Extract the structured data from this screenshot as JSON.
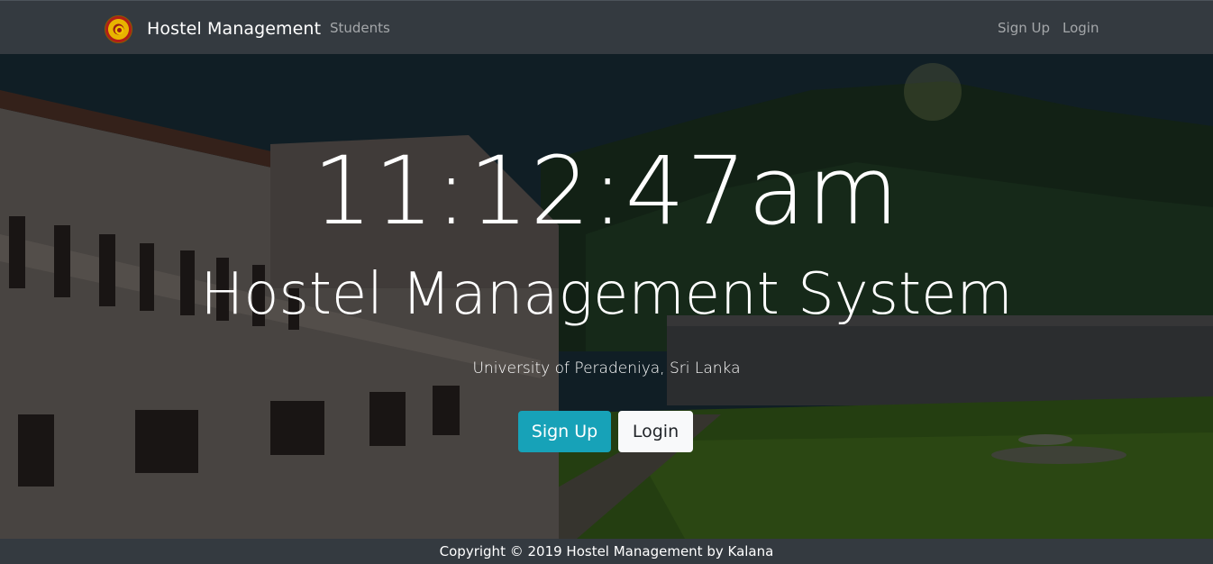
{
  "navbar": {
    "brand_text": "Hostel Management",
    "links": {
      "students": "Students",
      "signup": "Sign Up",
      "login": "Login"
    }
  },
  "hero": {
    "clock": "11:12:47am",
    "title": "Hostel Management System",
    "subtitle": "University of Peradeniya, Sri Lanka",
    "signup_button": "Sign Up",
    "login_button": "Login"
  },
  "footer": {
    "copyright": "Copyright © 2019 Hostel Management by Kalana"
  },
  "colors": {
    "navbar_bg": "#343a40",
    "accent_info": "#17a2b8",
    "light_button": "#f8f9fa"
  },
  "icons": {
    "brand_logo": "university-crest-logo"
  }
}
